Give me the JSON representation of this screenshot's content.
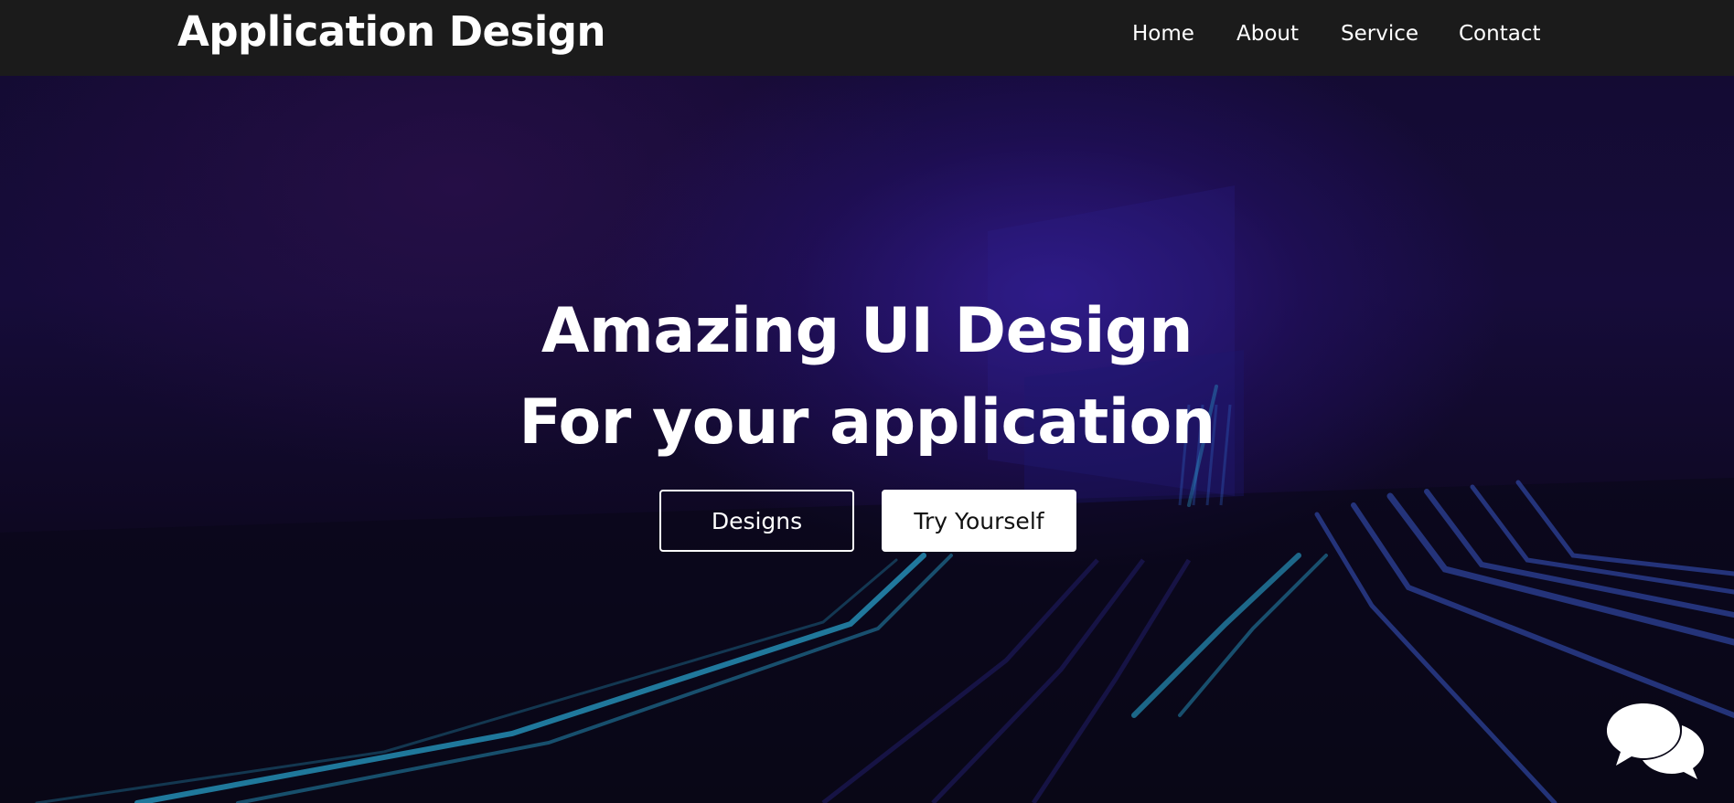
{
  "header": {
    "brand": "Application Design",
    "nav": [
      {
        "label": "Home"
      },
      {
        "label": "About"
      },
      {
        "label": "Service"
      },
      {
        "label": "Contact"
      }
    ]
  },
  "hero": {
    "line1": "Amazing UI Design",
    "line2": "For your application",
    "primary_button": "Designs",
    "secondary_button": "Try Yourself"
  },
  "chat": {
    "icon": "chat-bubbles-icon"
  },
  "colors": {
    "navbar": "#1b1b1b",
    "hero_dark": "#0b0717",
    "hero_glow": "#341c96",
    "accent_lines": "#2fb3d6",
    "text": "#ffffff"
  }
}
